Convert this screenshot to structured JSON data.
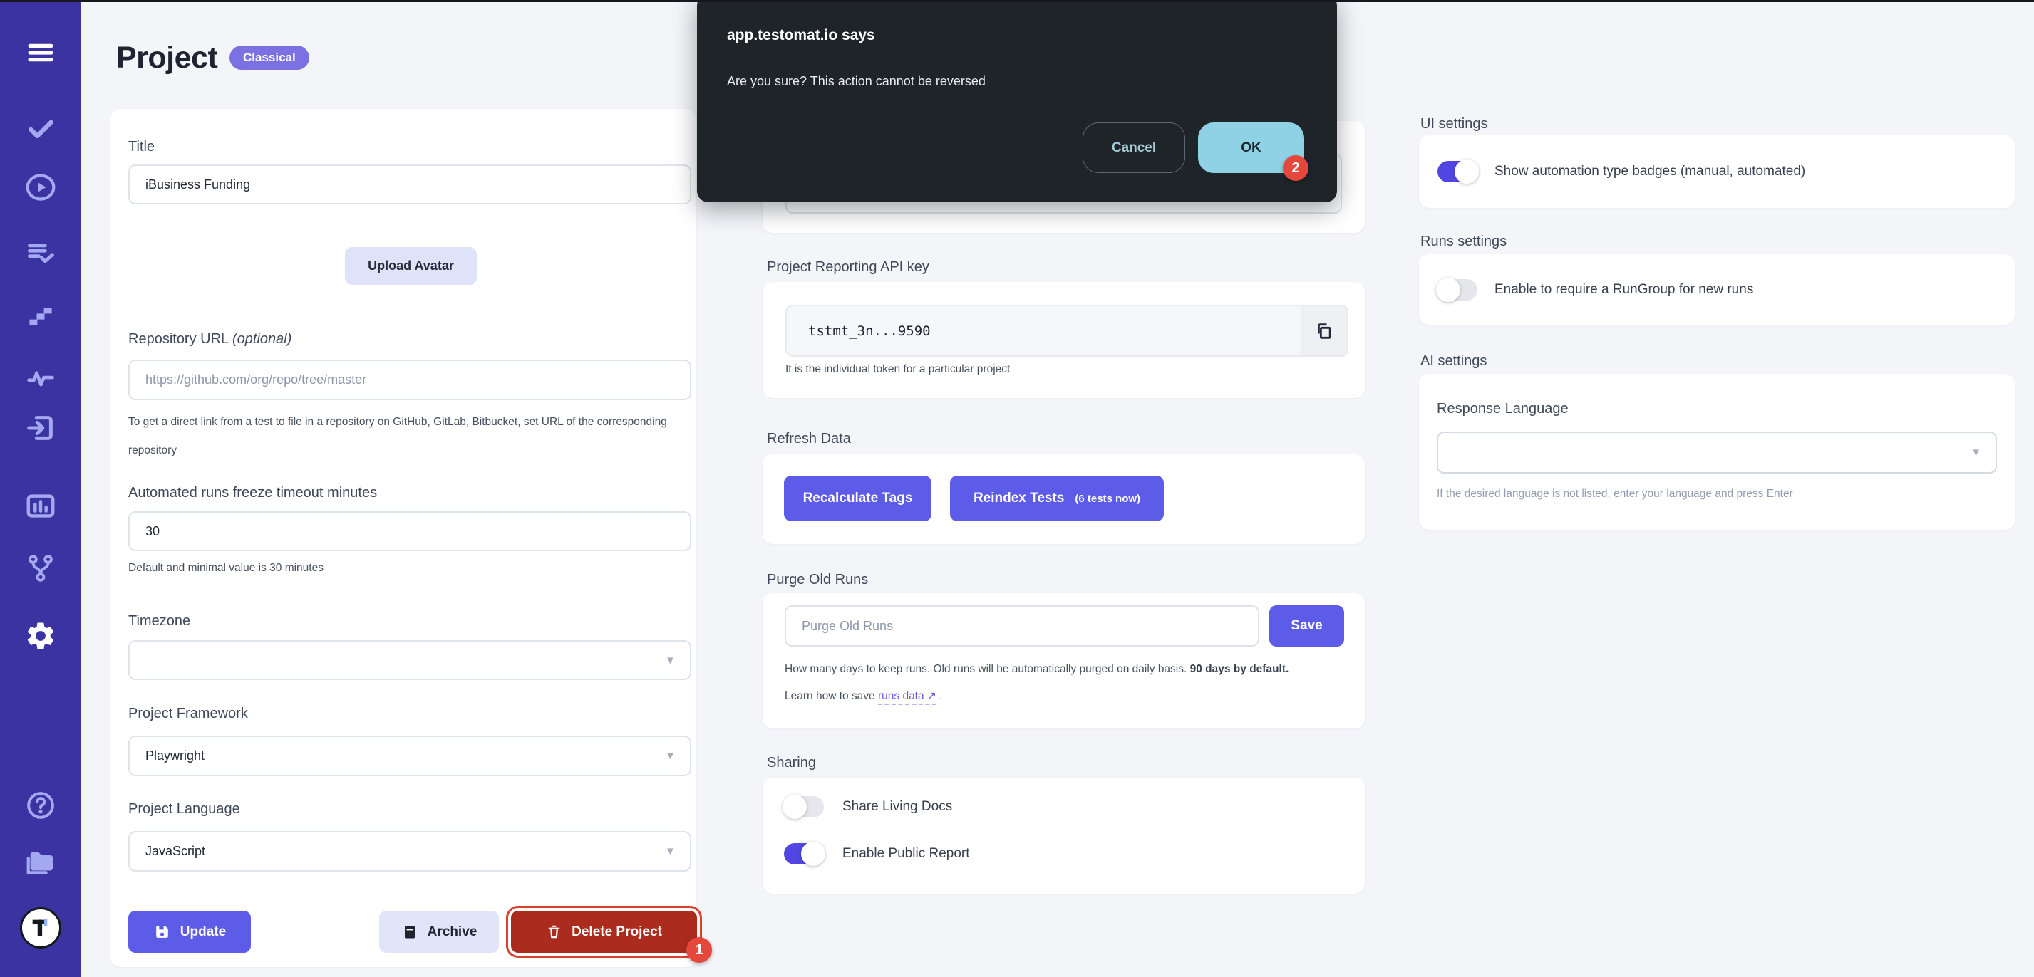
{
  "sidebar": {
    "icons": [
      "menu",
      "check",
      "play-circle",
      "list-check",
      "steps",
      "activity",
      "sign-in",
      "bar-chart",
      "git-branch",
      "gear",
      "help-circle",
      "folder",
      "testomat-logo"
    ]
  },
  "header": {
    "title": "Project",
    "badge": "Classical"
  },
  "dialog": {
    "source": "app.testomat.io says",
    "message": "Are you sure? This action cannot be reversed",
    "cancel_label": "Cancel",
    "ok_label": "OK"
  },
  "annotations": {
    "ok_badge": "2",
    "delete_badge": "1"
  },
  "left": {
    "title_label": "Title",
    "title_value": "iBusiness Funding",
    "upload_avatar_label": "Upload Avatar",
    "repo_label": "Repository URL ",
    "repo_label_optional": "(optional)",
    "repo_placeholder": "https://github.com/org/repo/tree/master",
    "repo_hint": "To get a direct link from a test to file in a repository on GitHub, GitLab, Bitbucket, set URL of the corresponding repository",
    "timeout_label": "Automated runs freeze timeout minutes",
    "timeout_value": "30",
    "timeout_hint": "Default and minimal value is 30 minutes",
    "timezone_label": "Timezone",
    "framework_label": "Project Framework",
    "framework_value": "Playwright",
    "language_label": "Project Language",
    "language_value": "JavaScript",
    "update_label": "Update",
    "archive_label": "Archive",
    "delete_label": "Delete Project"
  },
  "middle": {
    "api_key_label": "Project Reporting API key",
    "api_key_value": "tstmt_3n...9590",
    "api_key_hint": "It is the individual token for a particular project",
    "refresh_label": "Refresh Data",
    "recalculate_label": "Recalculate Tags",
    "reindex_label": "Reindex Tests",
    "reindex_sub": "(6 tests now)",
    "purge_label": "Purge Old Runs",
    "purge_placeholder": "Purge Old Runs",
    "save_label": "Save",
    "purge_hint_1": "How many days to keep runs. Old runs will be automatically purged on daily basis. ",
    "purge_hint_bold": "90 days by default.",
    "purge_hint_2": " Learn how to save ",
    "purge_link": "runs data",
    "purge_link_arrow": "↗",
    "purge_hint_3": " .",
    "sharing_label": "Sharing",
    "share_living_docs_label": "Share Living Docs",
    "enable_public_report_label": "Enable Public Report"
  },
  "right": {
    "ui_settings_label": "UI settings",
    "show_badges_label": "Show automation type badges (manual, automated)",
    "runs_settings_label": "Runs settings",
    "rungroup_label": "Enable to require a RunGroup for new runs",
    "ai_settings_label": "AI settings",
    "response_language_label": "Response Language",
    "response_language_hint": "If the desired language is not listed, enter your language and press Enter"
  },
  "toggles": {
    "share_living_docs": false,
    "enable_public_report": true,
    "show_automation_badges": true,
    "require_rungroup": false
  },
  "colors": {
    "sidebar": "#3a33a1",
    "accent_indigo": "#5c5ce9",
    "toggle_on": "#5246e2",
    "badge_purple": "#7b71e3",
    "danger_red": "#ab2b1f",
    "annotation_red": "#e5473d",
    "dialog_bg": "#1e2427",
    "ok_button": "#8fd2e6",
    "page_bg": "#f4f5f9"
  }
}
